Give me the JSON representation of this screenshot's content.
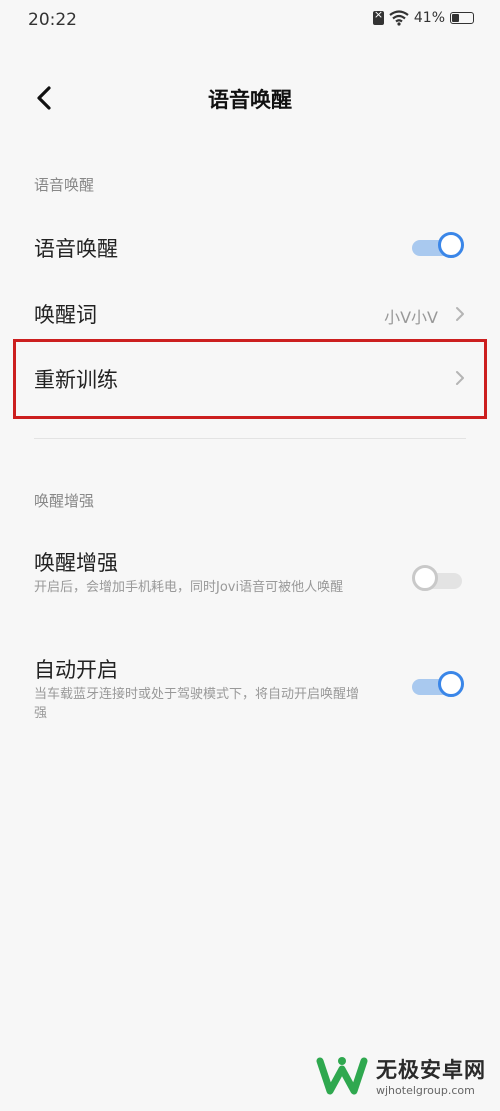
{
  "status_bar": {
    "time": "20:22",
    "battery_percent": "41%",
    "battery_level": 0.41
  },
  "header": {
    "title": "语音唤醒"
  },
  "sections": {
    "voice_wake": {
      "title": "语音唤醒",
      "voice_wake_row": {
        "label": "语音唤醒",
        "enabled": true
      },
      "wake_word_row": {
        "label": "唤醒词",
        "value": "小V小V"
      },
      "retrain_row": {
        "label": "重新训练"
      }
    },
    "wake_enhance": {
      "title": "唤醒增强",
      "enhance_row": {
        "label": "唤醒增强",
        "description": "开启后，会增加手机耗电，同时Jovi语音可被他人唤醒",
        "enabled": false
      },
      "auto_start_row": {
        "label": "自动开启",
        "description": "当车载蓝牙连接时或处于驾驶模式下，将自动开启唤醒增强",
        "enabled": true
      }
    }
  },
  "watermark": {
    "name": "无极安卓网",
    "url": "wjhotelgroup.com"
  },
  "colors": {
    "accent": "#3a86e8",
    "highlight": "#cc1f1f"
  }
}
